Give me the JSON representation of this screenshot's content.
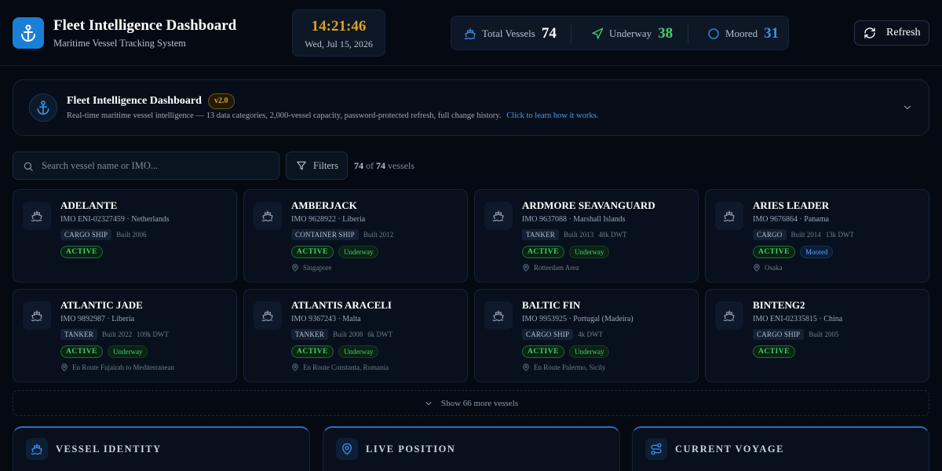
{
  "header": {
    "title": "Fleet Intelligence Dashboard",
    "subtitle": "Maritime Vessel Tracking System",
    "logo_icon": "anchor-icon",
    "clock": {
      "time": "14:21:46",
      "date": "Wed, Jul 15, 2026"
    },
    "stats": [
      {
        "label": "Total Vessels",
        "value": "74",
        "icon": "ship-icon",
        "color": "#ffffff"
      },
      {
        "label": "Underway",
        "value": "38",
        "icon": "navigation-icon",
        "color": "#3fcf6a"
      },
      {
        "label": "Moored",
        "value": "31",
        "icon": "circle-icon",
        "color": "#3a8fe8"
      }
    ],
    "refresh_label": "Refresh"
  },
  "banner": {
    "title": "Fleet Intelligence Dashboard",
    "version": "v2.0",
    "description": "Real-time maritime vessel intelligence — 13 data categories, 2,000-vessel capacity, password-protected refresh, full change history.",
    "link_text": "Click to learn how it works."
  },
  "search": {
    "placeholder": "Search vessel name or IMO...",
    "filters_label": "Filters",
    "shown": "74",
    "total": "74",
    "of_text": "of",
    "unit": "vessels"
  },
  "vessels": [
    {
      "name": "ADELANTE",
      "imo": "IMO ENI-02327459",
      "flag": "· Netherlands",
      "type": "CARGO SHIP",
      "built": "Built 2006",
      "dwt": "",
      "status": "ACTIVE",
      "motion": "",
      "location": ""
    },
    {
      "name": "AMBERJACK",
      "imo": "IMO 9628922",
      "flag": "· Liberia",
      "type": "CONTAINER SHIP",
      "built": "Built 2012",
      "dwt": "",
      "status": "ACTIVE",
      "motion": "Underway",
      "location": "Singapore"
    },
    {
      "name": "ARDMORE SEAVANGUARD",
      "imo": "IMO 9637088",
      "flag": "· Marshall Islands",
      "type": "TANKER",
      "built": "Built 2013",
      "dwt": "48k DWT",
      "status": "ACTIVE",
      "motion": "Underway",
      "location": "Rotterdam Area"
    },
    {
      "name": "ARIES LEADER",
      "imo": "IMO 9676864",
      "flag": "· Panama",
      "type": "CARGO",
      "built": "Built 2014",
      "dwt": "13k DWT",
      "status": "ACTIVE",
      "motion": "Moored",
      "location": "Osaka"
    },
    {
      "name": "ATLANTIC JADE",
      "imo": "IMO 9892987",
      "flag": "· Liberia",
      "type": "TANKER",
      "built": "Built 2022",
      "dwt": "109k DWT",
      "status": "ACTIVE",
      "motion": "Underway",
      "location": "En Route Fujairah to Mediterranean"
    },
    {
      "name": "ATLANTIS ARACELI",
      "imo": "IMO 9367243",
      "flag": "· Malta",
      "type": "TANKER",
      "built": "Built 2008",
      "dwt": "6k DWT",
      "status": "ACTIVE",
      "motion": "Underway",
      "location": "En Route Constanta, Romania"
    },
    {
      "name": "BALTIC FIN",
      "imo": "IMO 9953925",
      "flag": "· Portugal (Madeira)",
      "type": "CARGO SHIP",
      "built": "",
      "dwt": "4k DWT",
      "status": "ACTIVE",
      "motion": "Underway",
      "location": "En Route Palermo, Sicily"
    },
    {
      "name": "BINTENG2",
      "imo": "IMO ENI-02335815",
      "flag": "· China",
      "type": "CARGO SHIP",
      "built": "Built 2005",
      "dwt": "",
      "status": "ACTIVE",
      "motion": "",
      "location": ""
    }
  ],
  "show_more_label": "Show 66 more vessels",
  "panels": [
    {
      "title": "VESSEL IDENTITY",
      "icon": "ship-icon"
    },
    {
      "title": "LIVE POSITION",
      "icon": "map-pin-icon"
    },
    {
      "title": "CURRENT VOYAGE",
      "icon": "route-icon"
    }
  ],
  "colors": {
    "background": "#050a12",
    "accent": "#1b7fd6",
    "clock": "#e0a020",
    "active_green": "#3fcf6a",
    "moored_blue": "#56a8ff",
    "link": "#4a9be8"
  }
}
